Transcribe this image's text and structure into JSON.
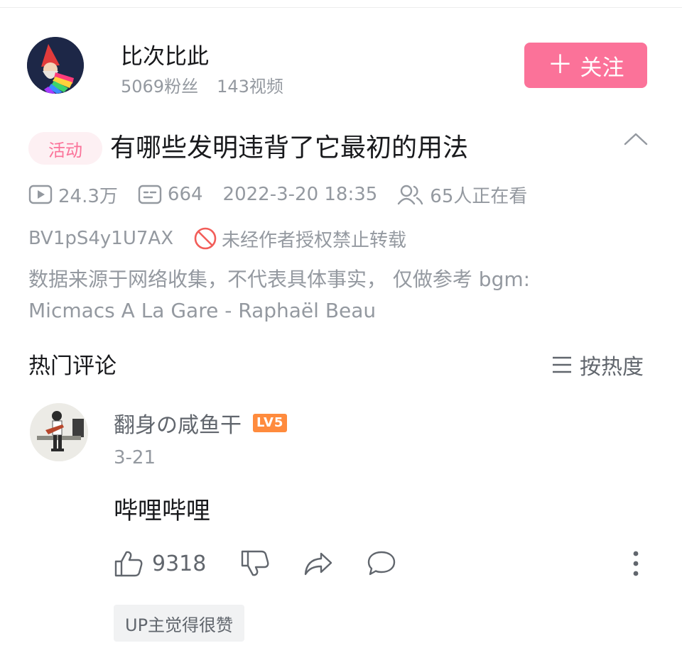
{
  "uploader": {
    "name": "比次比此",
    "fans": "5069粉丝",
    "videos": "143视频",
    "follow_label": "关注",
    "follow_icon": "plus-icon"
  },
  "video": {
    "tag": "活动",
    "title": "有哪些发明违背了它最初的用法",
    "views": "24.3万",
    "danmaku": "664",
    "datetime": "2022-3-20 18:35",
    "watching": "65人正在看",
    "bvid": "BV1pS4y1U7AX",
    "copyright": "未经作者授权禁止转载",
    "description_line1": "数据来源于网络收集，不代表具体事实， 仅做参考 bgm:",
    "description_line2": "Micmacs A La Gare - Raphaël Beau"
  },
  "comments": {
    "section_title": "热门评论",
    "sort_label": "按热度",
    "items": [
      {
        "user": "翻身の咸鱼干",
        "level": "LV5",
        "date": "3-21",
        "text": "哔哩哔哩",
        "likes": "9318",
        "up_liked": "UP主觉得很赞"
      }
    ]
  },
  "colors": {
    "brand_pink": "#fb7299",
    "level_orange": "#ff8b3d",
    "muted_text": "#9499a0",
    "warning_red": "#f25d59"
  }
}
